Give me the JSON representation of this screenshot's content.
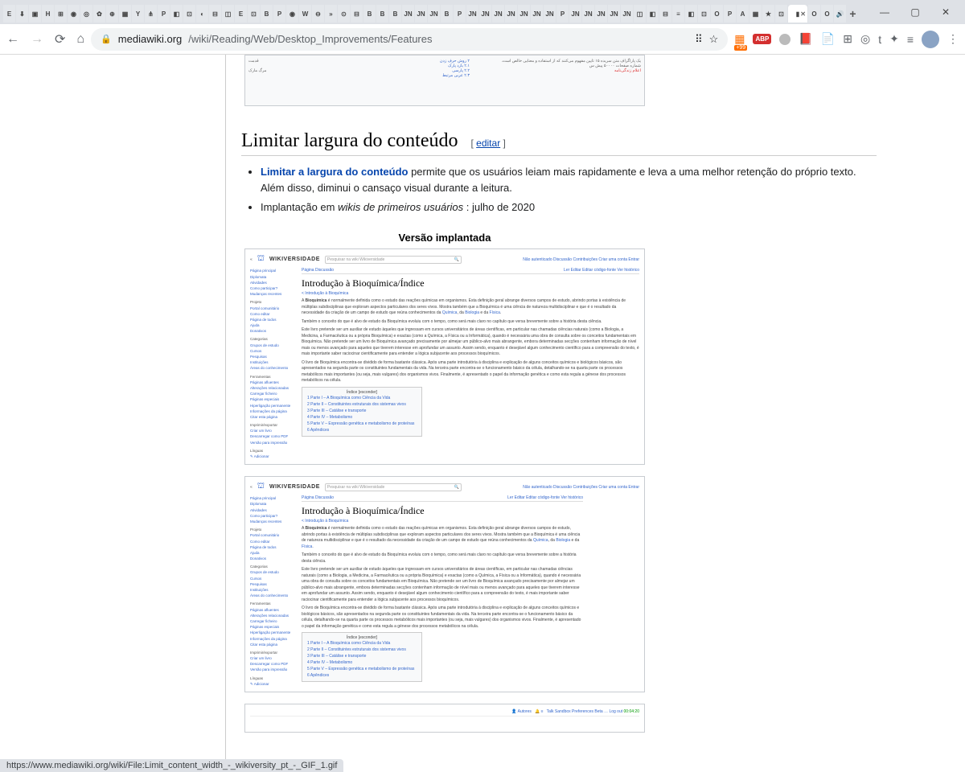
{
  "window": {
    "minimize": "—",
    "maximize": "▢",
    "close": "✕",
    "new_tab": "+"
  },
  "toolbar": {
    "back": "←",
    "forward": "→",
    "reload": "⟳",
    "home": "⌂",
    "translate": "⠿",
    "star": "☆",
    "menu": "⋮",
    "extensions": "✦",
    "list": "≡"
  },
  "url": {
    "lock": "🔒",
    "domain": "mediawiki.org",
    "path": "/wiki/Reading/Web/Desktop_Improvements/Features"
  },
  "ext": {
    "abp": "ABP",
    "pdf": "📕",
    "t": "t",
    "badge99": "+99"
  },
  "heading": {
    "title": "Limitar largura do conteúdo",
    "bracket_open": "[ ",
    "edit": "editar",
    "bracket_close": " ]"
  },
  "list": {
    "item1_link": "Limitar a largura do conteúdo",
    "item1_rest": " permite que os usuários leiam mais rapidamente e leva a uma melhor retenção do próprio texto. Além disso, diminui o cansaço visual durante a leitura.",
    "item2_pre": "Implantação em ",
    "item2_em": "wikis de primeiros usuários",
    "item2_post": " : julho de 2020"
  },
  "version_label": "Versão implantada",
  "wikiversity": {
    "logo": "WIKIVERSIDADE",
    "search_ph": "Pesquisar na wiki Wikiversidade",
    "toplinks": "Não autenticado   Discussão   Contribuições   Criar uma conta   Entrar",
    "tabs_left": "Página   Discussão",
    "tabs_right": "Ler   Editar   Editar código-fonte   Ver histórico",
    "article_title": "Introdução à Bioquímica/Índice",
    "breadcrumb": "< Introdução à Bioquímica",
    "sidebar": {
      "main": "Página principal",
      "dep": "Diplomata",
      "atv": "Atividades",
      "como": "Como participar?",
      "mud": "Mudanças recentes",
      "g_projeto": "Projeto",
      "portal": "Portal comunitário",
      "edit": "Como editar",
      "todos": "Página de todos",
      "ajuda": "Ajuda",
      "donativos": "Donativos",
      "g_cat": "Categorias",
      "grupos": "Grupos de estudo",
      "cursos": "Cursos",
      "pesq": "Pesquisas",
      "inst": "Instituições",
      "areas": "Áreas do conhecimento",
      "g_ferr": "Ferramentas",
      "afl": "Páginas afluentes",
      "alt": "Alterações relacionadas",
      "car": "Carregar ficheiro",
      "esp": "Páginas especiais",
      "perm": "Hiperligação permanente",
      "info": "Informações da página",
      "citar": "Citar esta página",
      "g_imp": "Imprimir/exportar",
      "livro": "Criar um livro",
      "pdf": "Descarregar como PDF",
      "print": "Versão para impressão",
      "g_lang": "Línguas",
      "addlinks": "✎ Adicionar"
    },
    "para1_pre": "A ",
    "para1_b": "Bioquímica",
    "para1_rest": " é normalmente definida como o estudo das reações químicas em organismos. Esta definição geral abrange diversos campos de estudo, abrindo portas à existência de múltiplas subdisciplinas que exploram aspectos particulares dos seres vivos. Mostra também que a Bioquímica é uma ciência de natureza multidisciplinar e que é o resultado da necessidade da criação de um campo de estudo que reúna conhecimentos da ",
    "para1_l1": "Química",
    "para1_mid": ", da ",
    "para1_l2": "Biologia",
    "para1_mid2": " e da ",
    "para1_l3": "Física",
    "para1_end": ".",
    "para2": "Também o conceito do que é alvo de estudo da Bioquímica evoluiu com o tempo, como será mais claro no capítulo que versa brevemente sobre a história desta ciência.",
    "para3": "Este livro pretende ser um auxiliar de estudo àqueles que ingressam em cursos universitários de áreas científicas, em particular nas chamadas ciências naturais (como a Biologia, a Medicina, a Farmacêutica ou a própria Bioquímica) e exactas (como a Química, a Física ou a Informática), quando é necessária uma obra de consulta sobre os conceitos fundamentais em Bioquímica. Não pretende ser um livro de Bioquímica avançado precisamente por almejar um público-alvo mais abrangente, embora determinadas secções contenham informação de nível mais ou menos avançado para aqueles que tiverem interesse em aprofundar um assunto. Assim sendo, enquanto é desejável algum conhecimento científico para a compreensão do texto, é mais importante saber raciocinar cientificamente para entender a lógica subjacente aos processos bioquímicos.",
    "para4": "O livro de Bioquímica encontra-se dividido de forma bastante clássica. Após uma parte introdutória à disciplina e explicação de alguns conceitos químicos e biológicos básicos, são apresentados na segunda parte os constituintes fundamentais da vida. Na terceira parte encontra-se o funcionamento básico da célula, detalhando-se na quarta parte os processos metabólicos mais importantes (ou seja, mais vulgares) dos organismos vivos. Finalmente, é apresentado o papel da informação genética e como esta regula a génese dos processos metabólicos na célula.",
    "toc": {
      "head": "Índice [esconder]",
      "i1": "1  Parte I – A Bioquímica como Ciência da Vida",
      "i2": "2  Parte II – Constituintes estruturais dos sistemas vivos",
      "i3": "3  Parte III – Catálise e transporte",
      "i4": "4  Parte IV – Metabolismo",
      "i5": "5  Parte V – Expressão genética e metabolismo de proteínas",
      "i6": "6  Apêndices"
    }
  },
  "status_bar": "https://www.mediawiki.org/wiki/File:Limit_content_width_-_wikiversity_pt_-_GIF_1.gif",
  "tab_icons": [
    "E",
    "⬇",
    "▣",
    "H",
    "⊞",
    "◉",
    "◎",
    "✿",
    "⊕",
    "▦",
    "Y",
    "⋔",
    "P",
    "◧",
    "⊡",
    "◐",
    "⊟",
    "◫",
    "E",
    "⊡",
    "B",
    "P",
    "◉",
    "W",
    "⊖",
    "»",
    "⊙",
    "⊟",
    "B",
    "B",
    "B",
    "JN",
    "JN",
    "JN",
    "B",
    "P",
    "JN",
    "JN",
    "JN",
    "JN",
    "JN",
    "JN",
    "JN",
    "P",
    "JN",
    "JN",
    "JN",
    "JN",
    "JN",
    "◫",
    "◧",
    "⊟",
    "≡",
    "◧",
    "⊡",
    "O",
    "P",
    "A",
    "▦",
    "★",
    "⊡"
  ],
  "active_tab_icon": "▮",
  "post_tabs": [
    "O",
    "O",
    "🔊"
  ]
}
